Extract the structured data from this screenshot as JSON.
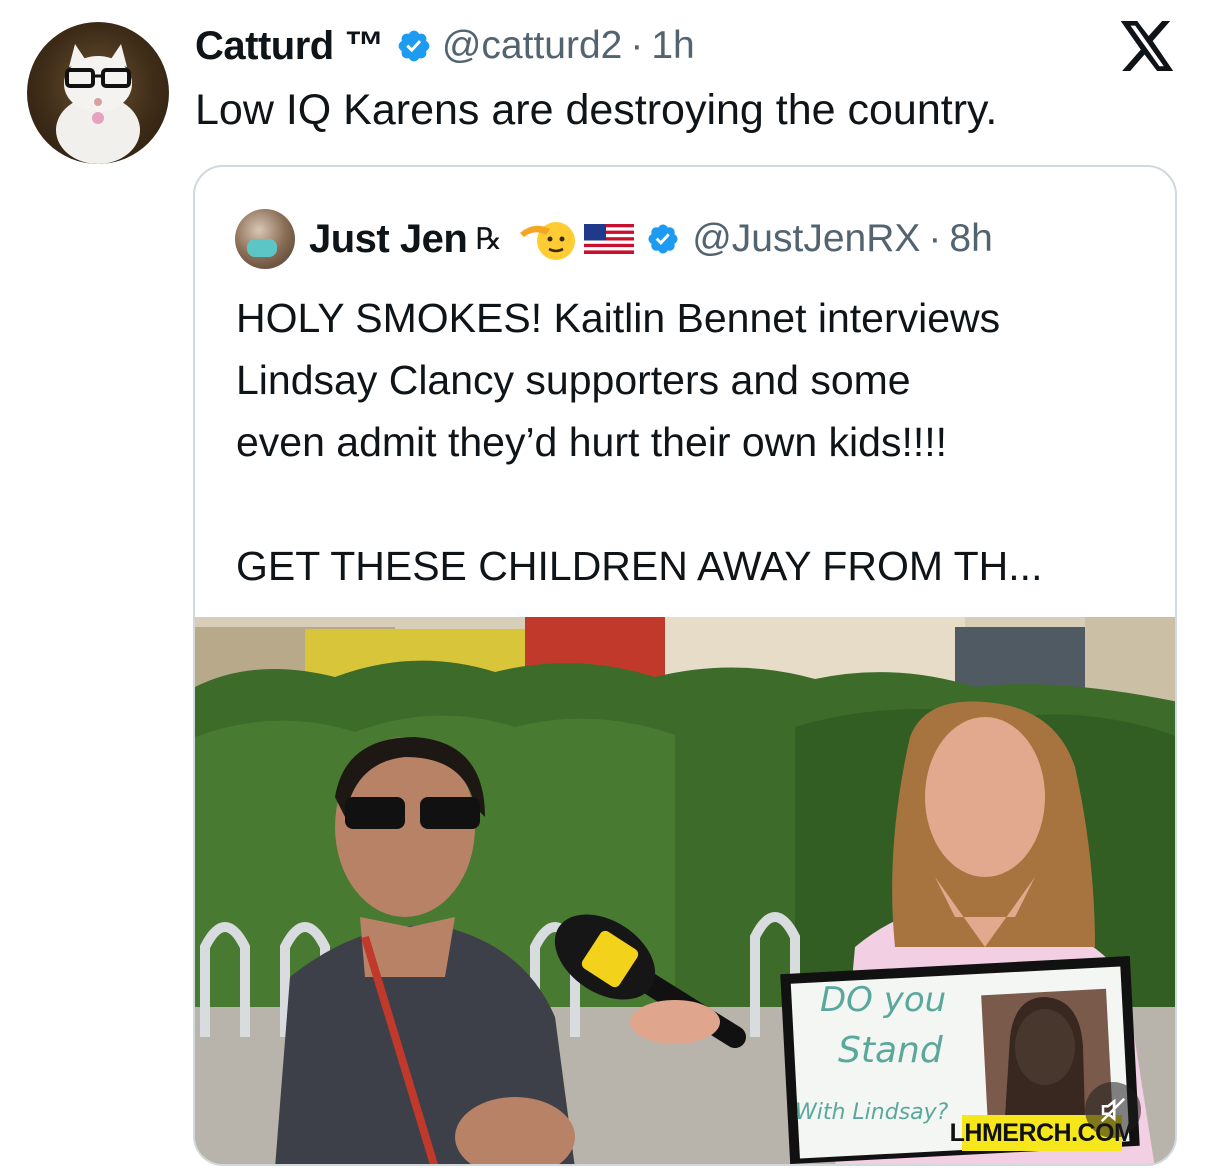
{
  "tweet": {
    "author_name": "Catturd ™",
    "handle": "@catturd2",
    "separator": "·",
    "time": "1h",
    "text": "Low IQ Karens are destroying the country."
  },
  "quote": {
    "author_name": "Just Jen",
    "rx_symbol": "℞",
    "handle": "@JustJenRX",
    "separator": "·",
    "time": "8h",
    "lines": [
      "HOLY SMOKES! Kaitlin Bennet interviews",
      "Lindsay Clancy supporters and some",
      "even admit they’d hurt their own kids!!!!",
      "GET THESE CHILDREN AWAY FROM TH..."
    ]
  },
  "media": {
    "sign_line1": "DO you",
    "sign_line2": "Stand",
    "sign_line3": "With Lindsay?",
    "watermark": "LHMERCH.COM"
  },
  "icons": {
    "verified": "verified-badge-icon",
    "x_logo": "x-logo-icon",
    "mute": "muted-speaker-icon",
    "salute": "saluting-face-emoji",
    "flag": "us-flag-emoji"
  },
  "colors": {
    "verified": "#1d9bf0",
    "secondary_text": "#536471",
    "card_border": "#cfd9de"
  }
}
